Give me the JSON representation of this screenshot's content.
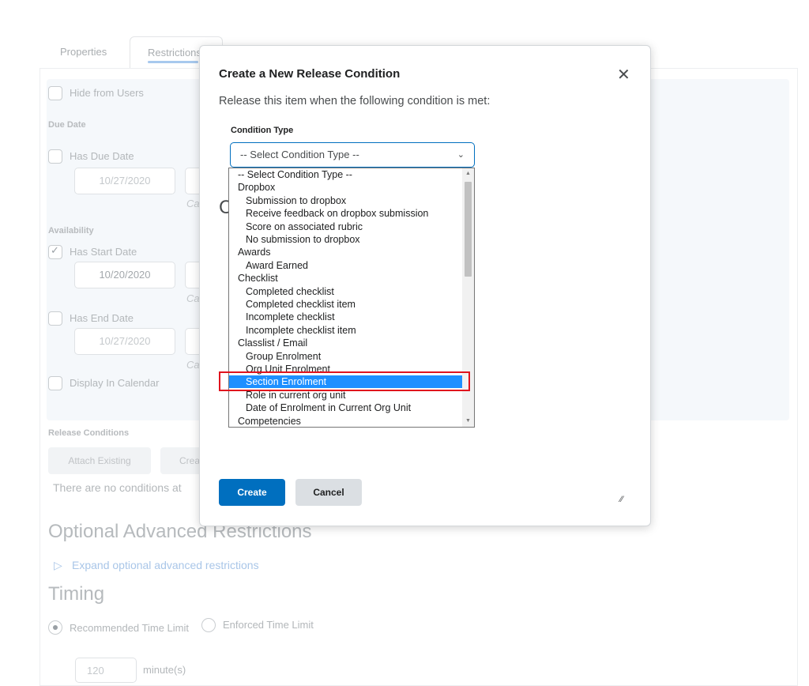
{
  "tabs": [
    "Properties",
    "Restrictions"
  ],
  "form": {
    "hide_from_users": "Hide from Users",
    "due_date_heading": "Due Date",
    "has_due_date": "Has Due Date",
    "due_date_value": "10/27/2020",
    "availability_heading": "Availability",
    "has_start_date": "Has Start Date",
    "start_date_value": "10/20/2020",
    "has_end_date": "Has End Date",
    "end_date_value": "10/27/2020",
    "calendar_abbrev": "Ca",
    "display_in_calendar": "Display In Calendar",
    "release_conditions_heading": "Release Conditions",
    "attach_existing": "Attach Existing",
    "create_partial": "Crea",
    "no_conditions": "There are no conditions at",
    "optional_advanced": "Optional Advanced Restrictions",
    "expand_advanced": "Expand optional advanced restrictions",
    "timing": "Timing",
    "recommended_time_limit": "Recommended Time Limit",
    "enforced_time_limit": "Enforced Time Limit",
    "time_value": "120",
    "minutes": "minute(s)"
  },
  "modal": {
    "title": "Create a New Release Condition",
    "close_glyph": "✕",
    "subtitle": "Release this item when the following condition is met:",
    "condition_type_label": "Condition Type",
    "select_value": "-- Select Condition Type --",
    "select_chevron": "⌄",
    "hidden_letter": "C",
    "create_button": "Create",
    "cancel_button": "Cancel",
    "resize_glyph": "⁄⁄"
  },
  "dropdown": {
    "options": [
      {
        "label": "-- Select Condition Type --",
        "kind": "group"
      },
      {
        "label": "Dropbox",
        "kind": "group"
      },
      {
        "label": "Submission to dropbox",
        "kind": "child"
      },
      {
        "label": "Receive feedback on dropbox submission",
        "kind": "child"
      },
      {
        "label": "Score on associated rubric",
        "kind": "child"
      },
      {
        "label": "No submission to dropbox",
        "kind": "child"
      },
      {
        "label": "Awards",
        "kind": "group"
      },
      {
        "label": "Award Earned",
        "kind": "child"
      },
      {
        "label": "Checklist",
        "kind": "group"
      },
      {
        "label": "Completed checklist",
        "kind": "child"
      },
      {
        "label": "Completed checklist item",
        "kind": "child"
      },
      {
        "label": "Incomplete checklist",
        "kind": "child"
      },
      {
        "label": "Incomplete checklist item",
        "kind": "child"
      },
      {
        "label": "Classlist / Email",
        "kind": "group"
      },
      {
        "label": "Group Enrolment",
        "kind": "child"
      },
      {
        "label": "Org Unit Enrolment",
        "kind": "child"
      },
      {
        "label": "Section Enrolment",
        "kind": "child",
        "selected": true
      },
      {
        "label": "Role in current org unit",
        "kind": "child"
      },
      {
        "label": "Date of Enrolment in Current Org Unit",
        "kind": "child"
      },
      {
        "label": "Competencies",
        "kind": "group"
      }
    ]
  },
  "colors": {
    "primary": "#006fbf",
    "highlight": "#1e90ff",
    "annotation_red": "#e0141e"
  }
}
